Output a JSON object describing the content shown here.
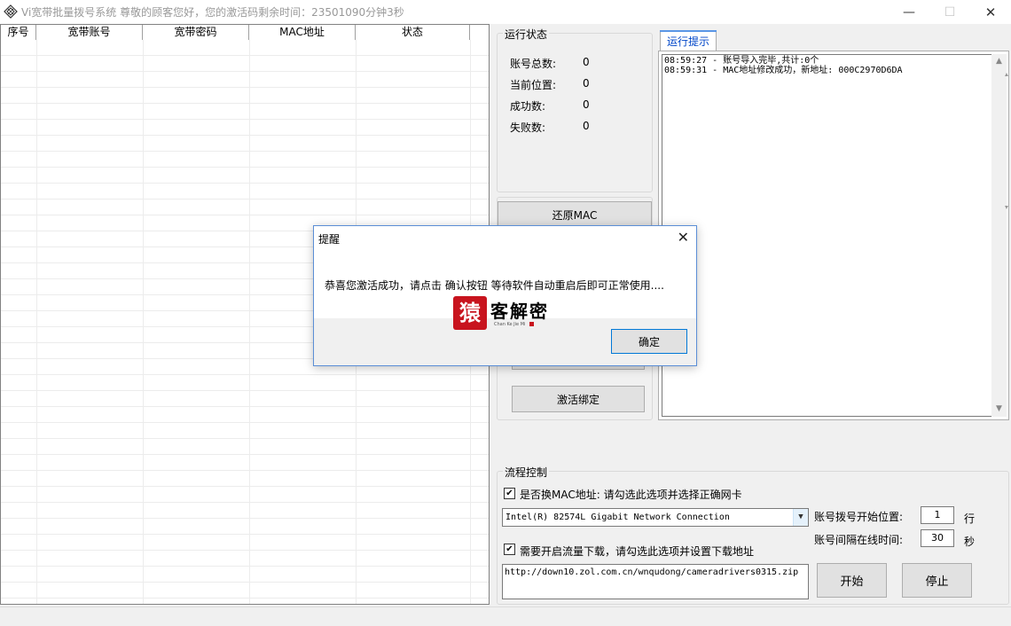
{
  "window": {
    "title": "Vi宽带批量拨号系统   尊敬的顾客您好，您的激活码剩余时间：23501090分钟3秒",
    "minimize": "—",
    "maximize": "☐",
    "close": "✕"
  },
  "table": {
    "columns": [
      "序号",
      "宽带账号",
      "宽带密码",
      "MAC地址",
      "状态"
    ]
  },
  "run_status": {
    "title": "运行状态",
    "items": [
      {
        "label": "账号总数:",
        "value": "0"
      },
      {
        "label": "当前位置:",
        "value": "0"
      },
      {
        "label": "成功数:",
        "value": "0"
      },
      {
        "label": "失败数:",
        "value": "0"
      }
    ],
    "restore_mac_button": "还原MAC",
    "activate_button": "激活绑定"
  },
  "log": {
    "tab_label": "运行提示",
    "lines": "08:59:27 - 账号导入完毕,共计:0个\n08:59:31 - MAC地址修改成功，新地址: 000C2970D6DA"
  },
  "flow": {
    "title": "流程控制",
    "mac_checkbox_label": "是否换MAC地址: 请勾选此选项并选择正确网卡",
    "mac_checked": true,
    "adapter": "Intel(R) 82574L Gigabit Network Connection",
    "start_pos_label": "账号拨号开始位置:",
    "start_pos_value": "1",
    "start_pos_unit": "行",
    "interval_label": "账号间隔在线时间:",
    "interval_value": "30",
    "interval_unit": "秒",
    "download_checkbox_label": "需要开启流量下载，请勾选此选项并设置下载地址",
    "download_checked": true,
    "url": "http://down10.zol.com.cn/wnqudong/cameradrivers0315.zip",
    "start_button": "开始",
    "stop_button": "停止"
  },
  "dialog": {
    "title": "提醒",
    "close": "✕",
    "message": "恭喜您激活成功，请点击 确认按钮 等待软件自动重启后即可正常使用....",
    "ok_button": "确定",
    "logo_text": "客解密",
    "logo_mark": "猿",
    "logo_sub": "Chan Ke Jie Mi"
  },
  "colors": {
    "accent": "#0078d7",
    "logo_red": "#c8141e",
    "tab_blue": "#0046c8"
  }
}
